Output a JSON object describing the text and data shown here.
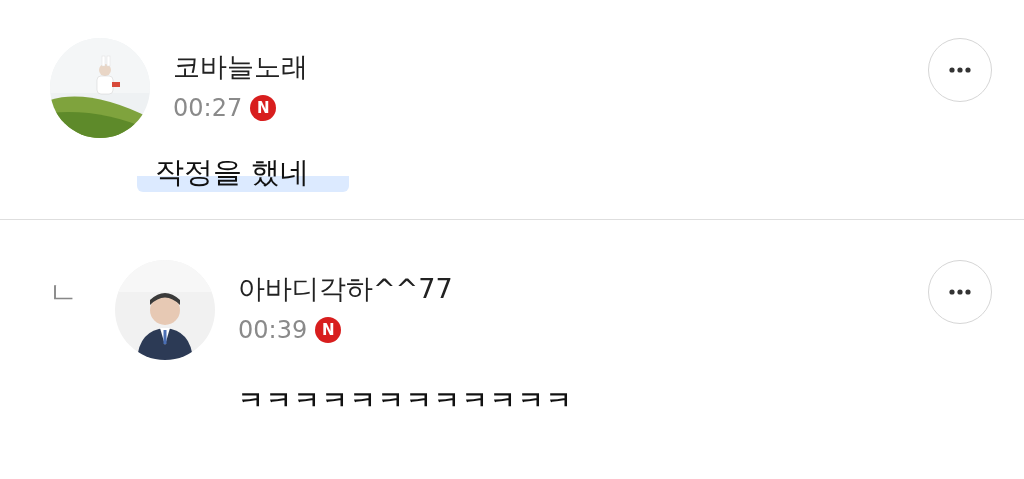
{
  "comments": [
    {
      "kind": "comment",
      "author": "코바늘노래",
      "time": "00:27",
      "badge": "N",
      "text": "작정을 했네",
      "highlighted": true
    },
    {
      "kind": "reply",
      "reply_mark": "ㄴ",
      "author": "아바디각하^^77",
      "time": "00:39",
      "badge": "N",
      "text": "ㅋㅋㅋㅋㅋㅋㅋㅋㅋㅋㅋㅋ",
      "highlighted": false
    }
  ]
}
